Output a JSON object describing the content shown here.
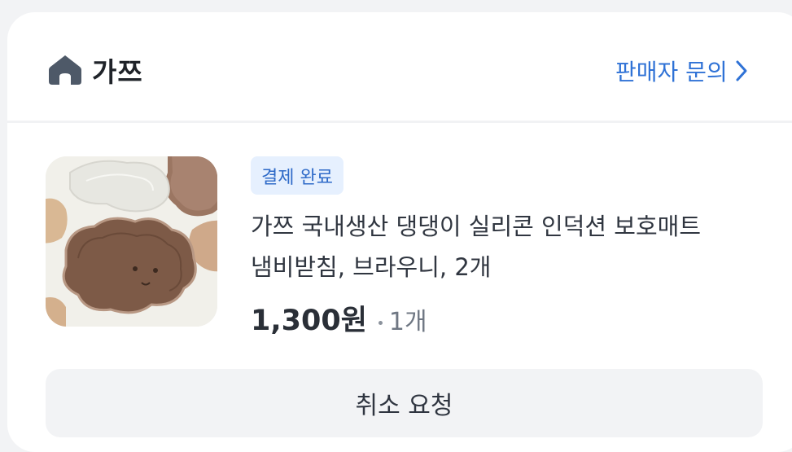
{
  "store": {
    "name": "가쯔",
    "contact_label": "판매자 문의"
  },
  "order": {
    "status": "결제 완료",
    "title_line1": "가쯔 국내생산 댕댕이 실리콘 인덕션 보호매트",
    "title_line2": "냄비받침, 브라우니, 2개",
    "price": "1,300원",
    "quantity": "1개"
  },
  "actions": {
    "cancel_label": "취소 요청"
  },
  "colors": {
    "accent": "#2f72d6",
    "badge_bg": "#e6f0fe",
    "badge_text": "#2e6ac8"
  },
  "icons": {
    "store": "home-icon",
    "contact": "chevron-right-icon"
  }
}
